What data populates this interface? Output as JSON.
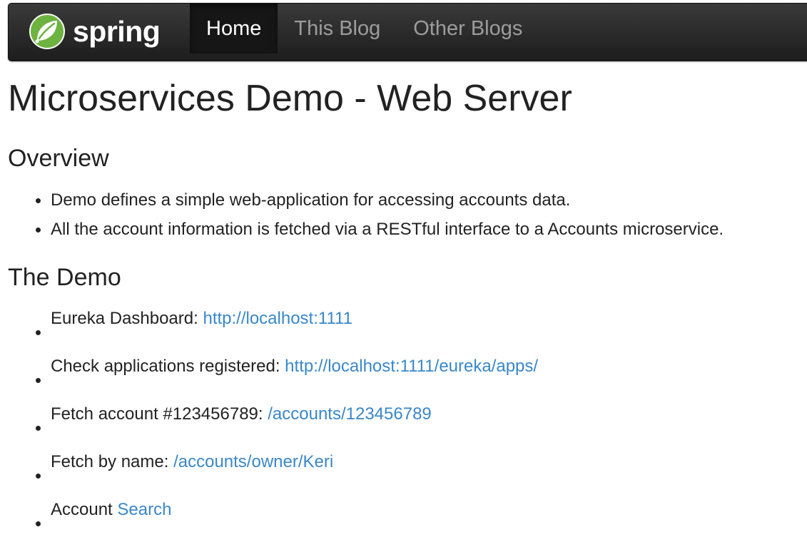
{
  "navbar": {
    "brand": "spring",
    "items": [
      {
        "label": "Home",
        "active": true
      },
      {
        "label": "This Blog"
      },
      {
        "label": "Other Blogs"
      }
    ]
  },
  "page": {
    "title": "Microservices Demo - Web Server",
    "overview": {
      "heading": "Overview",
      "items": [
        "Demo defines a simple web-application for accessing accounts data.",
        "All the account information is fetched via a RESTful interface to a Accounts microservice."
      ]
    },
    "demo": {
      "heading": "The Demo",
      "items": [
        {
          "text": "Eureka Dashboard: ",
          "link": "http://localhost:1111"
        },
        {
          "text": "Check applications registered: ",
          "link": "http://localhost:1111/eureka/apps/"
        },
        {
          "text": "Fetch account #123456789: ",
          "link": "/accounts/123456789"
        },
        {
          "text": "Fetch by name: ",
          "link": "/accounts/owner/Keri"
        },
        {
          "text": "Account ",
          "link": "Search"
        }
      ]
    }
  },
  "colors": {
    "link": "#3a87c9",
    "navbar": "#222222",
    "brand_green": "#6db33f"
  }
}
